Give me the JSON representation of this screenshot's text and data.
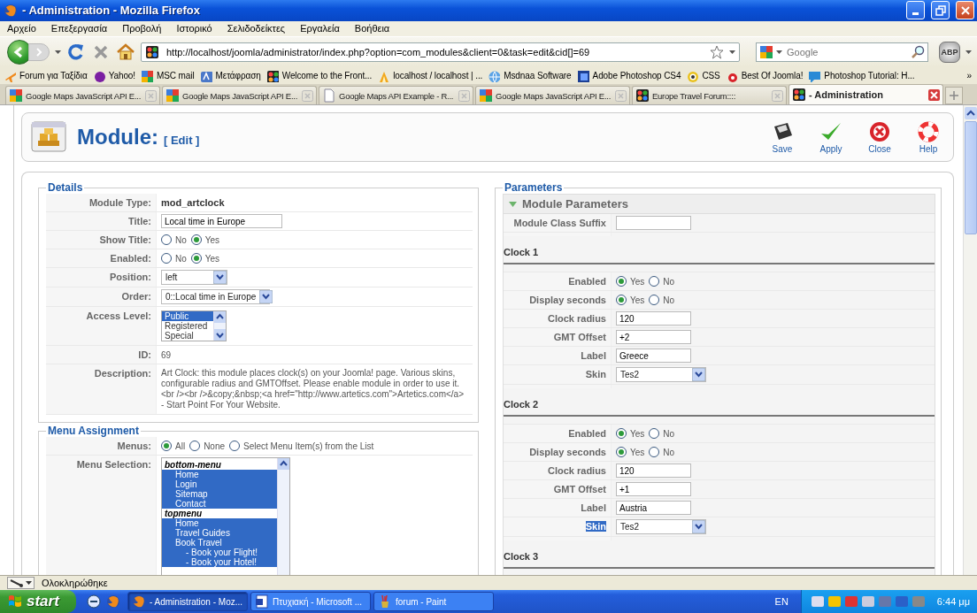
{
  "window": {
    "title": "- Administration - Mozilla Firefox"
  },
  "menu_bar": [
    "Αρχείο",
    "Επεξεργασία",
    "Προβολή",
    "Ιστορικό",
    "Σελιδοδείκτες",
    "Εργαλεία",
    "Βοήθεια"
  ],
  "nav": {
    "url": "http://localhost/joomla/administrator/index.php?option=com_modules&client=0&task=edit&cid[]=69",
    "search_placeholder": "Google",
    "addon_badge": "ABP"
  },
  "bookmarks": [
    {
      "kind": "plane",
      "label": "Forum για Ταξίδια"
    },
    {
      "kind": "badge",
      "label": "Yahoo!"
    },
    {
      "kind": "tiles",
      "label": "MSC mail"
    },
    {
      "kind": "translate",
      "label": "Μετάφραση"
    },
    {
      "kind": "cms",
      "label": "Welcome to the Front..."
    },
    {
      "kind": "pma",
      "label": "localhost / localhost | ..."
    },
    {
      "kind": "globe",
      "label": "Msdnaa Software"
    },
    {
      "kind": "square",
      "label": "Adobe Photoshop CS4"
    },
    {
      "kind": "ring",
      "label": "CSS"
    },
    {
      "kind": "bug",
      "label": "Best Of Joomla!"
    },
    {
      "kind": "chat",
      "label": "Photoshop Tutorial: H..."
    }
  ],
  "bookmarks_overflow": "»",
  "tabs": [
    {
      "kind": "tiles",
      "label": "Google Maps JavaScript API E...",
      "selected": false
    },
    {
      "kind": "tiles",
      "label": "Google Maps JavaScript API E...",
      "selected": false
    },
    {
      "kind": "page",
      "label": "Google Maps API Example - R...",
      "selected": false
    },
    {
      "kind": "tiles",
      "label": "Google Maps JavaScript API E...",
      "selected": false
    },
    {
      "kind": "cms",
      "label": "Europe Travel Forum::::",
      "selected": false
    },
    {
      "kind": "cms",
      "label": "- Administration",
      "selected": true
    }
  ],
  "header": {
    "title": "Module:",
    "subtitle": "[ Edit ]",
    "toolbar": [
      {
        "kind": "save",
        "label": "Save"
      },
      {
        "kind": "apply",
        "label": "Apply"
      },
      {
        "kind": "close",
        "label": "Close"
      },
      {
        "kind": "help",
        "label": "Help"
      }
    ]
  },
  "details": {
    "legend": "Details",
    "rows": [
      {
        "kind": "text",
        "label": "Module Type:",
        "value": "mod_artclock"
      },
      {
        "kind": "input",
        "label": "Title:",
        "value": "Local time in Europe"
      },
      {
        "kind": "radio",
        "label": "Show Title:",
        "options": [
          {
            "label": "No",
            "selected": false
          },
          {
            "label": "Yes",
            "selected": true
          }
        ]
      },
      {
        "kind": "radio",
        "label": "Enabled:",
        "options": [
          {
            "label": "No",
            "selected": false
          },
          {
            "label": "Yes",
            "selected": true
          }
        ]
      },
      {
        "kind": "select",
        "label": "Position:",
        "value": "left"
      },
      {
        "kind": "select",
        "label": "Order:",
        "value": "0::Local time in Europe"
      },
      {
        "kind": "listbox",
        "label": "Access Level:",
        "options": [
          {
            "label": "Public",
            "selected": true
          },
          {
            "label": "Registered",
            "selected": false
          },
          {
            "label": "Special",
            "selected": false
          }
        ]
      },
      {
        "kind": "plain",
        "label": "ID:",
        "value": "69"
      },
      {
        "kind": "para",
        "label": "Description:",
        "value": "Art Clock: this module places clock(s) on your Joomla! page. Various skins, configurable radius and GMTOffset. Please enable module in order to use it. <br /><br />&copy;&nbsp;<a href=\"http://www.artetics.com\">Artetics.com</a> - Start Point For Your Website."
      }
    ]
  },
  "menu_assignment": {
    "legend": "Menu Assignment",
    "rows": [
      {
        "kind": "radio",
        "label": "Menus:",
        "options": [
          {
            "label": "All",
            "selected": true
          },
          {
            "label": "None",
            "selected": false
          },
          {
            "label": "Select Menu Item(s) from the List",
            "selected": false
          }
        ]
      },
      {
        "kind": "tree",
        "label": "Menu Selection:",
        "items": [
          {
            "label": "bottom-menu",
            "children": [
              {
                "label": "Home",
                "selected": true
              },
              {
                "label": "Login",
                "selected": true
              },
              {
                "label": "Sitemap",
                "selected": true
              },
              {
                "label": "Contact",
                "selected": true
              }
            ]
          },
          {
            "label": "topmenu",
            "children": [
              {
                "label": "Home",
                "selected": true
              },
              {
                "label": "Travel Guides",
                "selected": true
              },
              {
                "label": "Book Travel",
                "selected": true,
                "children": [
                  {
                    "label": "- Book your Flight!",
                    "selected": true
                  },
                  {
                    "label": "- Book your Hotel!",
                    "selected": true
                  }
                ]
              }
            ]
          }
        ]
      }
    ]
  },
  "parameters": {
    "legend": "Parameters",
    "panel_title": "Module Parameters",
    "rows": [
      {
        "kind": "input",
        "label": "Module Class Suffix",
        "highlighted": false
      },
      {
        "kind": "heading",
        "label": "Clock 1"
      },
      {
        "kind": "radio",
        "label": "Enabled",
        "highlighted": false,
        "options": [
          {
            "label": "Yes",
            "selected": true
          },
          {
            "label": "No",
            "selected": false
          }
        ]
      },
      {
        "kind": "radio",
        "label": "Display seconds",
        "highlighted": false,
        "options": [
          {
            "label": "Yes",
            "selected": true
          },
          {
            "label": "No",
            "selected": false
          }
        ]
      },
      {
        "kind": "input",
        "label": "Clock radius",
        "value": "120",
        "highlighted": false
      },
      {
        "kind": "input",
        "label": "GMT Offset",
        "value": "+2",
        "highlighted": false
      },
      {
        "kind": "input",
        "label": "Label",
        "value": "Greece",
        "highlighted": false
      },
      {
        "kind": "select",
        "label": "Skin",
        "value": "Tes2",
        "highlighted": false
      },
      {
        "kind": "heading",
        "label": "Clock 2"
      },
      {
        "kind": "radio",
        "label": "Enabled",
        "highlighted": false,
        "options": [
          {
            "label": "Yes",
            "selected": true
          },
          {
            "label": "No",
            "selected": false
          }
        ]
      },
      {
        "kind": "radio",
        "label": "Display seconds",
        "highlighted": false,
        "options": [
          {
            "label": "Yes",
            "selected": true
          },
          {
            "label": "No",
            "selected": false
          }
        ]
      },
      {
        "kind": "input",
        "label": "Clock radius",
        "value": "120",
        "highlighted": false
      },
      {
        "kind": "input",
        "label": "GMT Offset",
        "value": "+1",
        "highlighted": false
      },
      {
        "kind": "input",
        "label": "Label",
        "value": "Austria",
        "highlighted": false
      },
      {
        "kind": "select",
        "label": "Skin",
        "value": "Tes2",
        "highlighted": true
      },
      {
        "kind": "heading",
        "label": "Clock 3"
      }
    ]
  },
  "status_bar": {
    "text": "Ολοκληρώθηκε"
  },
  "taskbar": {
    "start": "start",
    "tasks": [
      {
        "kind": "browser",
        "label": "- Administration - Moz...",
        "selected": true
      },
      {
        "kind": "doc",
        "label": "Πτυχιακή - Microsoft ...",
        "selected": false
      },
      {
        "kind": "paint",
        "label": "forum - Paint",
        "selected": false
      }
    ],
    "language": "EN",
    "clock": "6:44 μμ"
  }
}
